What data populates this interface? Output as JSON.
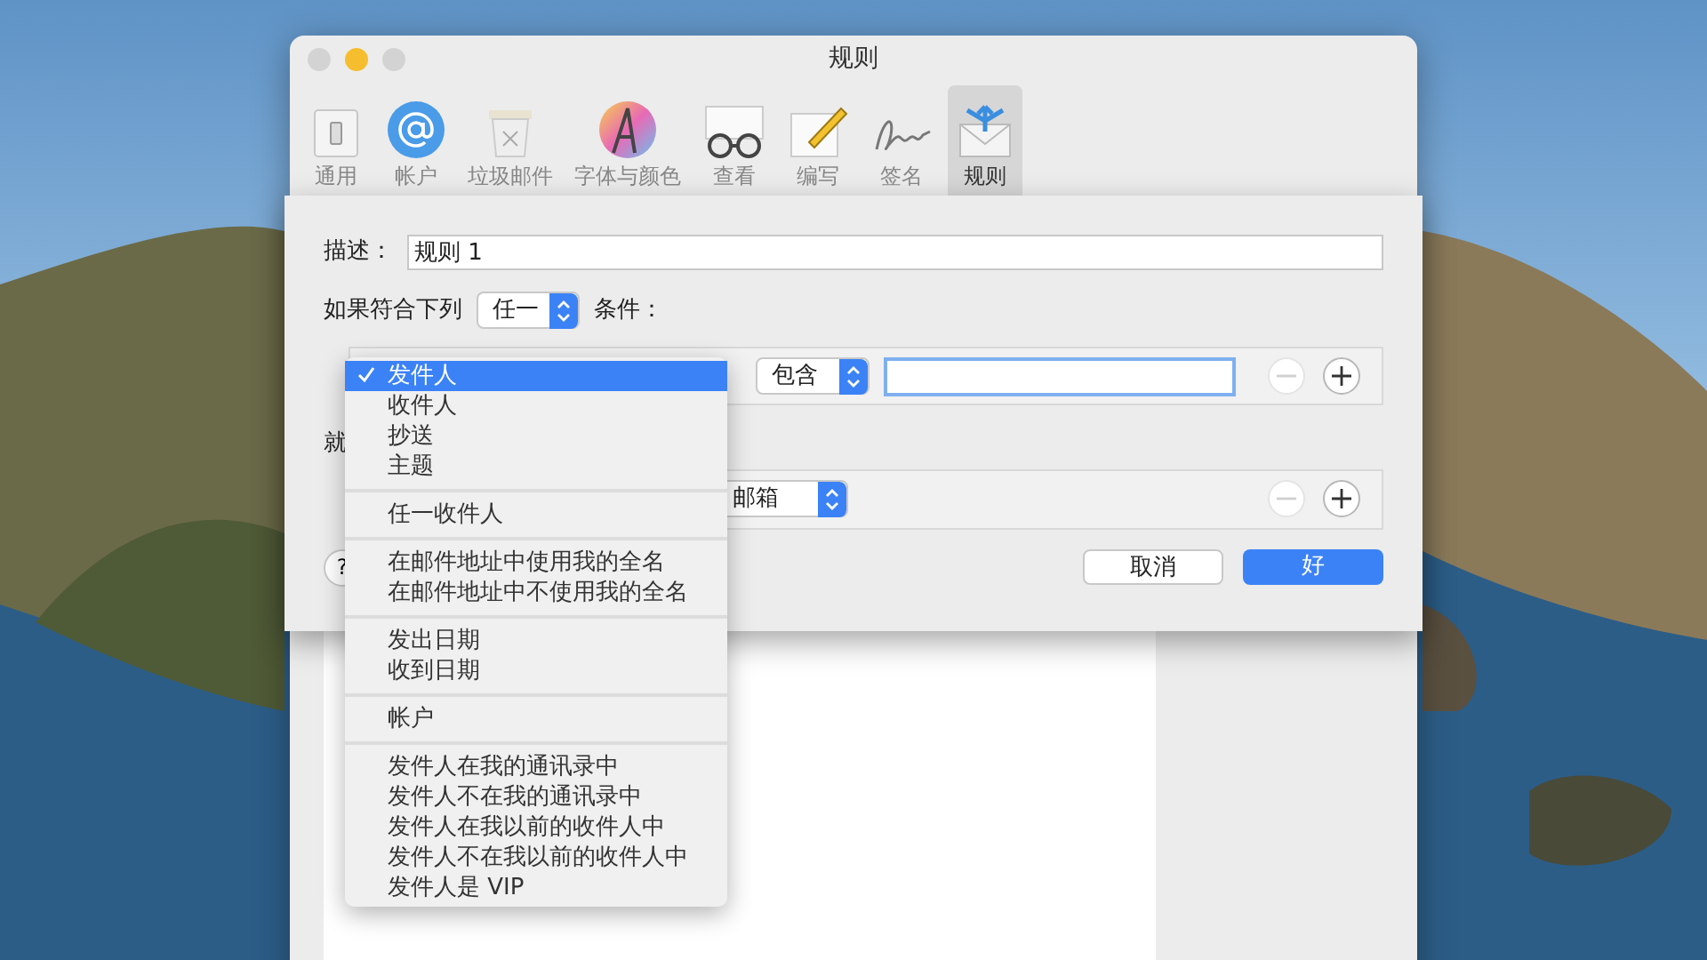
{
  "window": {
    "title": "规则"
  },
  "toolbar": [
    {
      "kind": "general",
      "label": "通用",
      "selected": false
    },
    {
      "kind": "accounts",
      "label": "帐户",
      "selected": false
    },
    {
      "kind": "junk",
      "label": "垃圾邮件",
      "selected": false
    },
    {
      "kind": "fonts",
      "label": "字体与颜色",
      "selected": false
    },
    {
      "kind": "viewing",
      "label": "查看",
      "selected": false
    },
    {
      "kind": "composing",
      "label": "编写",
      "selected": false
    },
    {
      "kind": "signatures",
      "label": "签名",
      "selected": false
    },
    {
      "kind": "rules",
      "label": "规则",
      "selected": true
    }
  ],
  "sheet": {
    "description_label": "描述：",
    "description_value": "规则 1",
    "match_prefix": "如果符合下列",
    "match_popup": "任一",
    "match_suffix": "条件：",
    "condition": {
      "operator": "包含",
      "remove_disabled": true
    },
    "actions_label": "就",
    "action": {
      "popup": "邮箱",
      "remove_disabled": true
    },
    "help_button": "?",
    "cancel_button": "取消",
    "ok_button": "好"
  },
  "menu": [
    [
      {
        "label": "发件人",
        "selected": true
      },
      {
        "label": "收件人",
        "selected": false
      },
      {
        "label": "抄送",
        "selected": false
      },
      {
        "label": "主题",
        "selected": false
      }
    ],
    [
      {
        "label": "任一收件人",
        "selected": false
      }
    ],
    [
      {
        "label": "在邮件地址中使用我的全名",
        "selected": false
      },
      {
        "label": "在邮件地址中不使用我的全名",
        "selected": false
      }
    ],
    [
      {
        "label": "发出日期",
        "selected": false
      },
      {
        "label": "收到日期",
        "selected": false
      }
    ],
    [
      {
        "label": "帐户",
        "selected": false
      }
    ],
    [
      {
        "label": "发件人在我的通讯录中",
        "selected": false
      },
      {
        "label": "发件人不在我的通讯录中",
        "selected": false
      },
      {
        "label": "发件人在我以前的收件人中",
        "selected": false
      },
      {
        "label": "发件人不在我以前的收件人中",
        "selected": false
      },
      {
        "label": "发件人是 VIP",
        "selected": false
      }
    ]
  ]
}
